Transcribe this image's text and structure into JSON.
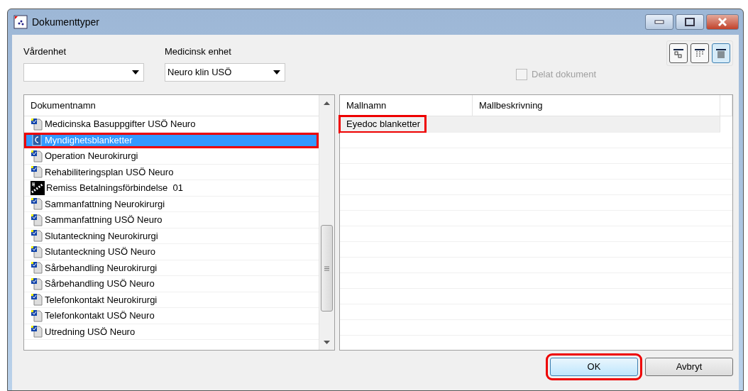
{
  "window": {
    "title": "Dokumenttyper"
  },
  "filters": [
    {
      "label": "Vårdenhet"
    },
    {
      "label": "Medicinsk enhet",
      "value": "Neuro klin USÖ"
    }
  ],
  "shared_document": {
    "label": "Delat dokument",
    "checked": false,
    "disabled": true
  },
  "view_buttons": [
    {
      "kind": "icons",
      "selected": false
    },
    {
      "kind": "small",
      "selected": false
    },
    {
      "kind": "details",
      "selected": true
    }
  ],
  "document_list": {
    "column": "Dokumentnamn",
    "rows": [
      {
        "name": "Medicinska Basuppgifter USÖ Neuro",
        "kind": "form",
        "selected": false,
        "highlighted": false
      },
      {
        "name": "Myndighetsblanketter",
        "kind": "eyedoc",
        "selected": true,
        "highlighted": true
      },
      {
        "name": "Operation Neurokirurgi",
        "kind": "form",
        "selected": false,
        "highlighted": false
      },
      {
        "name": "Rehabiliteringsplan USÖ Neuro",
        "kind": "form",
        "selected": false,
        "highlighted": false
      },
      {
        "name": "Remiss Betalningsförbindelse  01",
        "kind": "referral",
        "selected": false,
        "highlighted": false
      },
      {
        "name": "Sammanfattning Neurokirurgi",
        "kind": "form",
        "selected": false,
        "highlighted": false
      },
      {
        "name": "Sammanfattning USÖ Neuro",
        "kind": "form",
        "selected": false,
        "highlighted": false
      },
      {
        "name": "Slutanteckning Neurokirurgi",
        "kind": "form",
        "selected": false,
        "highlighted": false
      },
      {
        "name": "Slutanteckning USÖ Neuro",
        "kind": "form",
        "selected": false,
        "highlighted": false
      },
      {
        "name": "Sårbehandling Neurokirurgi",
        "kind": "form",
        "selected": false,
        "highlighted": false
      },
      {
        "name": "Sårbehandling USÖ Neuro",
        "kind": "form",
        "selected": false,
        "highlighted": false
      },
      {
        "name": "Telefonkontakt Neurokirurgi",
        "kind": "form",
        "selected": false,
        "highlighted": false
      },
      {
        "name": "Telefonkontakt USÖ Neuro",
        "kind": "form",
        "selected": false,
        "highlighted": false
      },
      {
        "name": "Utredning USÖ Neuro",
        "kind": "form",
        "selected": false,
        "highlighted": false
      }
    ]
  },
  "template_table": {
    "columns": [
      "Mallnamn",
      "Mallbeskrivning"
    ],
    "rows": [
      {
        "name": "Eyedoc blanketter",
        "highlighted": true
      }
    ]
  },
  "buttons": [
    {
      "label": "OK",
      "highlighted": true
    },
    {
      "label": "Avbryt",
      "highlighted": false
    }
  ]
}
